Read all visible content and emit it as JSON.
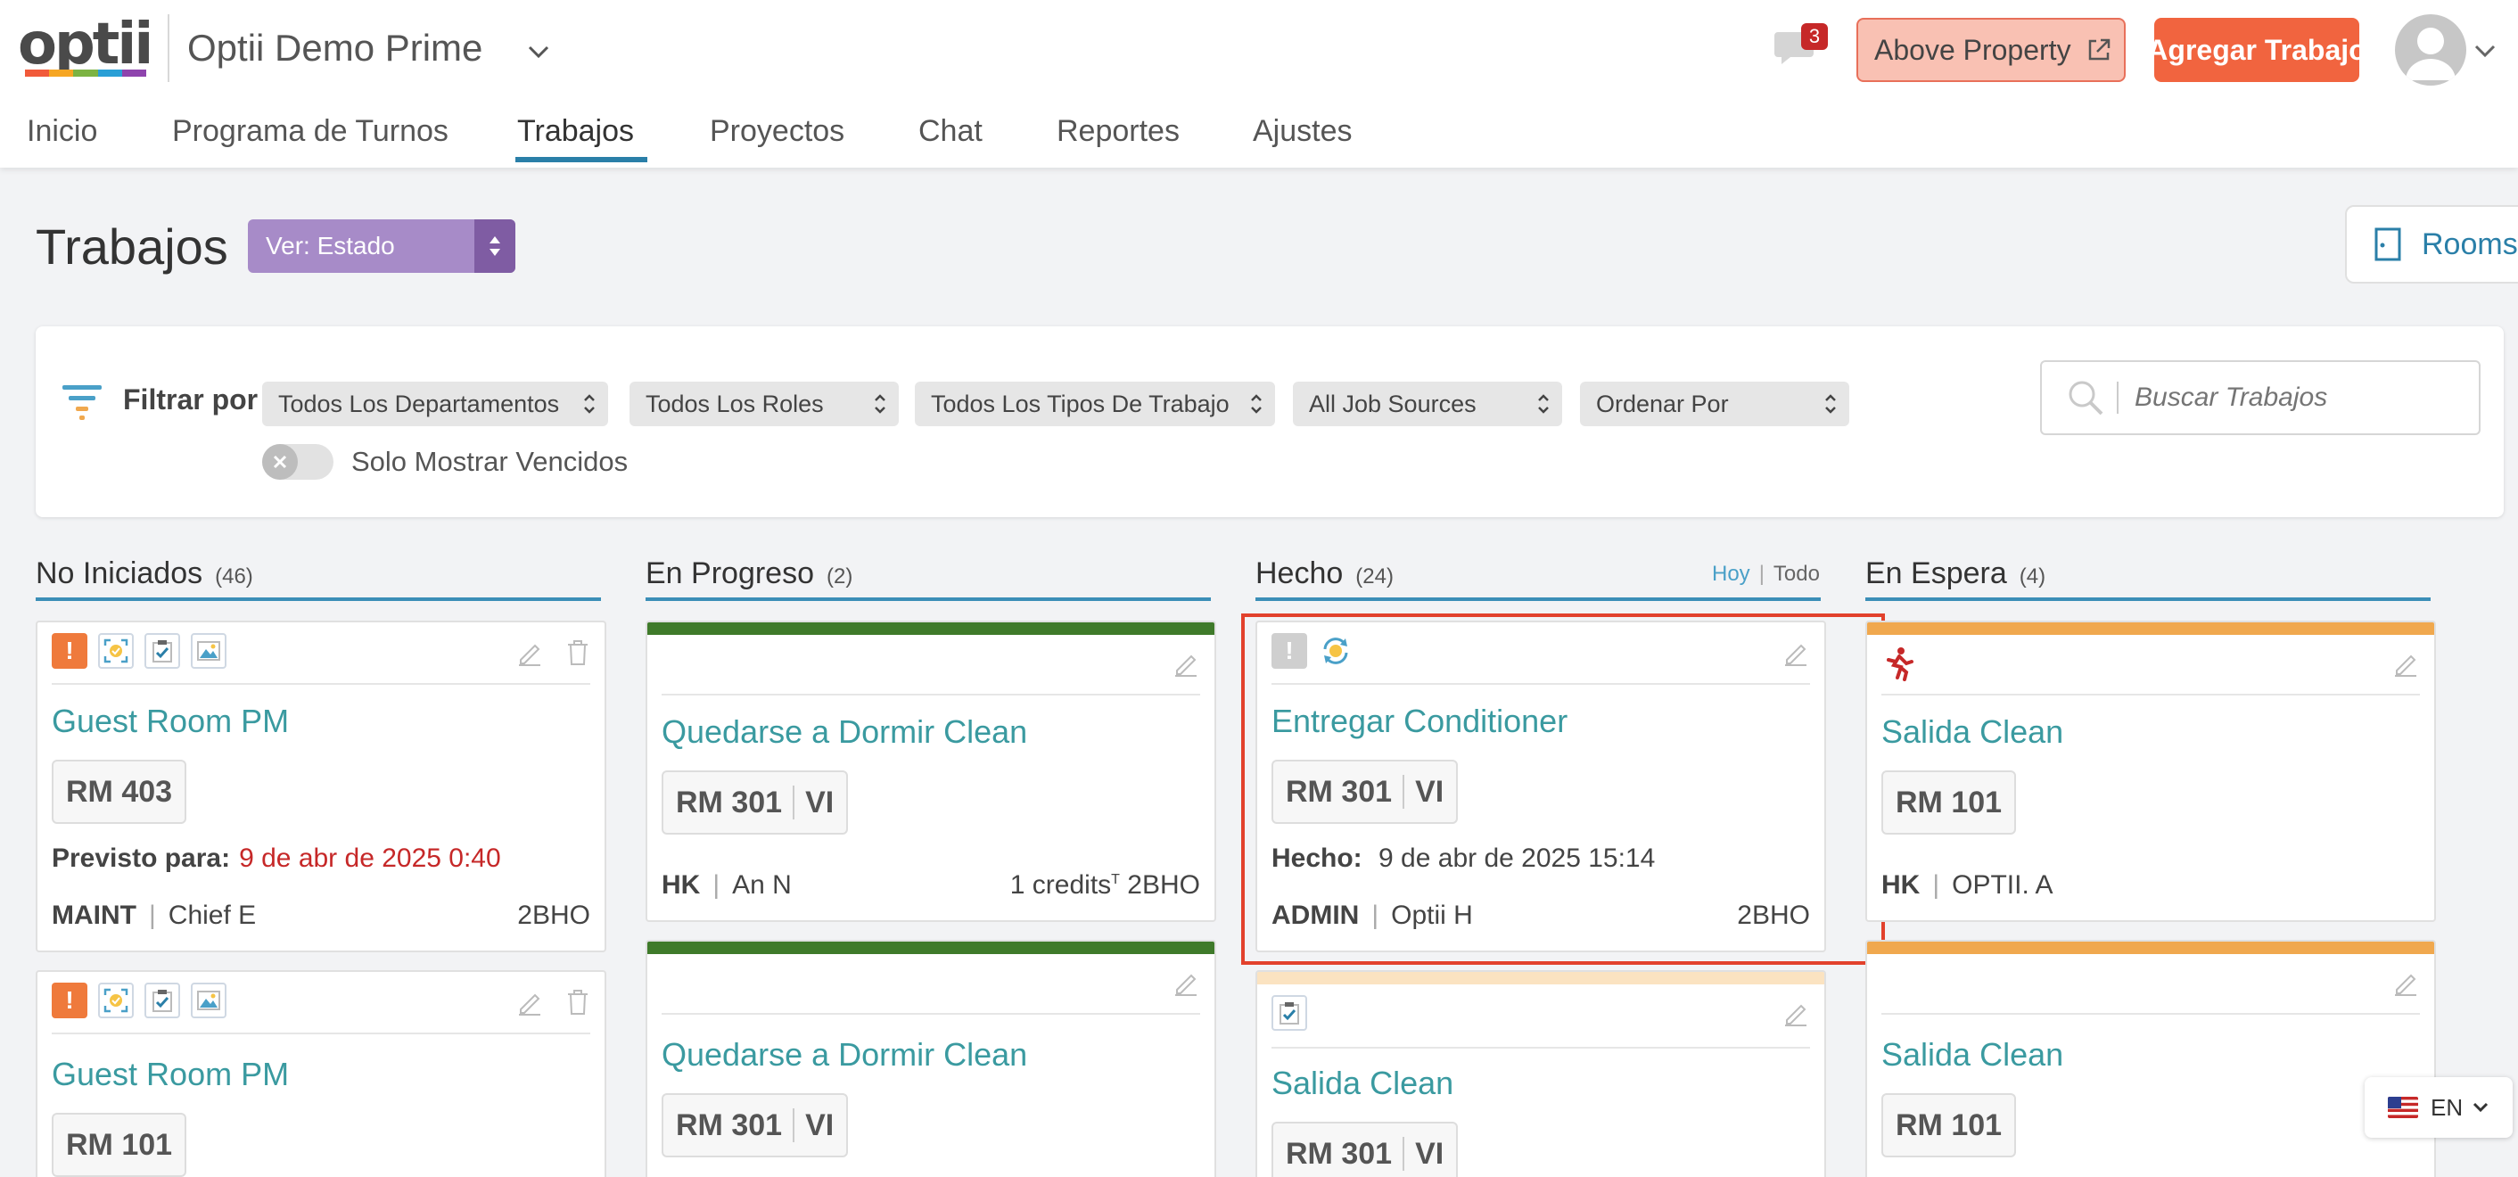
{
  "brand": {
    "logo_text": "optii",
    "logo_colors": [
      "#f15a3a",
      "#f6a623",
      "#7cb342",
      "#2a9fd6",
      "#8e44ad"
    ]
  },
  "header": {
    "property_name": "Optii Demo Prime",
    "notifications_count": "3",
    "above_property_label": "Above Property",
    "add_job_label": "Agregar Trabajo"
  },
  "nav": {
    "items": [
      {
        "label": "Inicio"
      },
      {
        "label": "Programa de Turnos"
      },
      {
        "label": "Trabajos"
      },
      {
        "label": "Proyectos"
      },
      {
        "label": "Chat"
      },
      {
        "label": "Reportes"
      },
      {
        "label": "Ajustes"
      }
    ],
    "active": "Trabajos"
  },
  "page": {
    "title": "Trabajos",
    "view_select": "Ver: Estado",
    "rooms_button": "Rooms"
  },
  "filters": {
    "label": "Filtrar por",
    "selects": [
      "Todos Los Departamentos",
      "Todos Los Roles",
      "Todos Los Tipos De Trabajo",
      "All Job Sources",
      "Ordenar Por"
    ],
    "overdue_toggle_label": "Solo Mostrar Vencidos",
    "search_placeholder": "Buscar Trabajos"
  },
  "columns": [
    {
      "title": "No Iniciados",
      "count": "(46)",
      "cards": [
        {
          "title": "Guest Room PM",
          "room": "RM 403",
          "due_label": "Previsto para:",
          "due_value": "9 de abr de 2025 0:40",
          "dept": "MAINT",
          "assignee": "Chief E",
          "code": "2BHO"
        },
        {
          "title": "Guest Room PM",
          "room": "RM 101"
        }
      ]
    },
    {
      "title": "En Progreso",
      "count": "(2)",
      "cards": [
        {
          "title": "Quedarse a Dormir Clean",
          "room": "RM 301",
          "room_type": "VI",
          "dept": "HK",
          "assignee": "An N",
          "credits": "1 credits",
          "credits_sup": "T",
          "code": "2BHO"
        },
        {
          "title": "Quedarse a Dormir Clean",
          "room": "RM 301",
          "room_type": "VI"
        }
      ]
    },
    {
      "title": "Hecho",
      "count": "(24)",
      "tabs": {
        "today": "Hoy",
        "all": "Todo"
      },
      "cards": [
        {
          "title": "Entregar Conditioner",
          "room": "RM 301",
          "room_type": "VI",
          "done_label": "Hecho:",
          "done_value": "9 de abr de 2025 15:14",
          "dept": "ADMIN",
          "assignee": "Optii H",
          "code": "2BHO"
        },
        {
          "title": "Salida Clean",
          "room": "RM 301",
          "room_type": "VI"
        }
      ]
    },
    {
      "title": "En Espera",
      "count": "(4)",
      "cards": [
        {
          "title": "Salida Clean",
          "room": "RM 101",
          "dept": "HK",
          "assignee": "OPTII. A"
        },
        {
          "title": "Salida Clean",
          "room": "RM 101"
        }
      ]
    }
  ],
  "language": {
    "code": "EN"
  },
  "colors": {
    "accent_blue": "#2a7fa8",
    "in_progress_bar": "#3f7a2a",
    "on_hold_bar": "#f0a84e",
    "done_second_bar": "#fbe3c1",
    "title_teal": "#3a9aa0",
    "overdue_red": "#c62828",
    "highlight_red": "#e2412c"
  }
}
